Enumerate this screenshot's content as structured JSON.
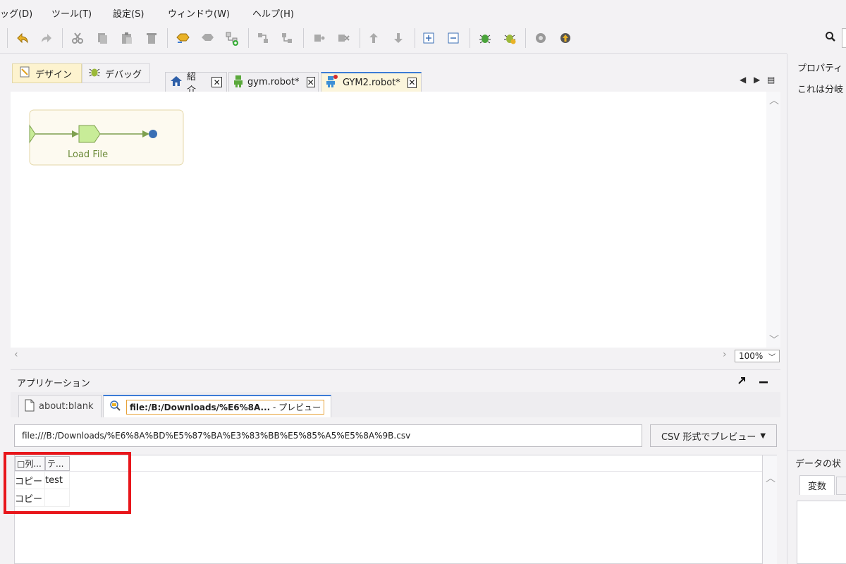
{
  "menu": {
    "items": [
      "ッグ(D)",
      "ツール(T)",
      "設定(S)",
      "ウィンドウ(W)",
      "ヘルプ(H)"
    ]
  },
  "toolbar": {
    "icons": [
      "undo-icon",
      "redo-icon",
      "cut-icon",
      "copy-icon",
      "paste-icon",
      "delete-icon",
      "group-icon",
      "ungroup-icon",
      "add-step-icon",
      "split-icon",
      "join-icon",
      "insert-before-icon",
      "insert-after-icon",
      "move-up-icon",
      "move-down-icon",
      "expand-icon",
      "collapse-icon",
      "debug-icon",
      "debug-step-icon",
      "settings-icon",
      "upload-icon",
      "search-icon"
    ]
  },
  "modes": {
    "design_label": "デザイン",
    "debug_label": "デバッグ"
  },
  "editor_tabs": [
    {
      "label": "紹介"
    },
    {
      "label": "gym.robot*"
    },
    {
      "label": "GYM2.robot*"
    }
  ],
  "canvas": {
    "step_label": "Load File",
    "zoom": "100%"
  },
  "right_panel": {
    "title": "プロパティ",
    "text": "これは分岐",
    "data_title": "データの状",
    "tab_label": "変数"
  },
  "application": {
    "title": "アプリケーション",
    "tabs": [
      {
        "label": "about:blank"
      },
      {
        "label": "file:/B:/Downloads/%E6%8A...",
        "suffix": " - プレビュー"
      }
    ],
    "address": "file:///B:/Downloads/%E6%8A%BD%E5%87%BA%E3%83%BB%E5%85%A5%E5%8A%9B.csv",
    "preview_mode": "CSV 形式でプレビュー"
  },
  "table": {
    "headers": [
      "□列...",
      "テ..."
    ],
    "rows": [
      [
        "コピー",
        "test"
      ],
      [
        "コピー",
        ""
      ]
    ]
  },
  "colors": {
    "accent_tab": "#3b7bd6",
    "highlight": "#e8161b",
    "step_fill": "#c8ec98",
    "flow_line": "#7ea04f",
    "end_dot": "#3a6fb5"
  }
}
